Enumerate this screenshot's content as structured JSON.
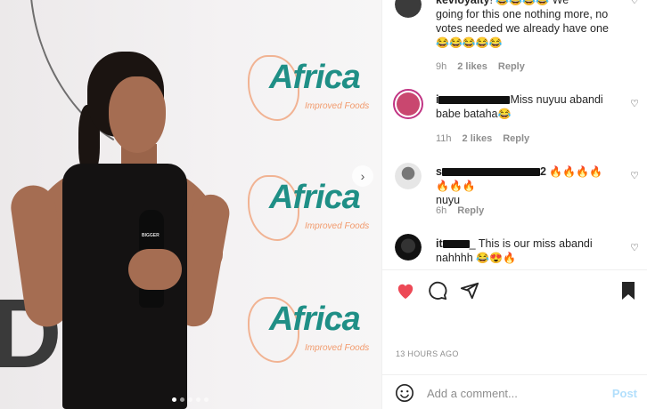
{
  "post": {
    "brand_text": "Africa",
    "brand_tagline": "Improved Foods",
    "backdrop_letter": "D",
    "mic_label": "BIGGER",
    "carousel_dots": 5,
    "active_dot": 0
  },
  "comments": [
    {
      "username_visible": "kevloyalty",
      "text_line1": "We going for this one nothing more, no",
      "text": "going for this one nothing more, no votes needed we already have one",
      "emojis_leading": "😂😂😂😂",
      "emojis": "😂😂😂😂😂",
      "time": "9h",
      "likes": "2 likes",
      "reply": "Reply"
    },
    {
      "username_visible": "i",
      "text": "Miss nuyuu abandi babe bataha",
      "emojis": "😂",
      "time": "11h",
      "likes": "2 likes",
      "reply": "Reply"
    },
    {
      "username_visible": "s",
      "username_suffix": "2",
      "emojis_leading": "🔥🔥🔥🔥🔥🔥🔥",
      "text": "nuyu",
      "time": "6h",
      "reply": "Reply"
    },
    {
      "username_visible": "it",
      "text": "_ This is our miss abandi nahhhh",
      "emojis": "😂😍🔥"
    }
  ],
  "actions": {
    "like_color": "#ed4956"
  },
  "timestamp": "13 HOURS AGO",
  "add_comment": {
    "placeholder": "Add a comment...",
    "post_label": "Post"
  }
}
